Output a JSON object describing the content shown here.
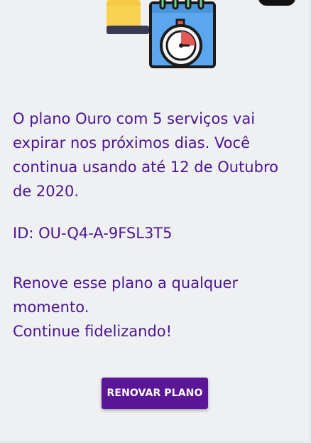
{
  "illustration": {
    "icon": "calendar-stopwatch-icon"
  },
  "message": {
    "text": "O plano Ouro com 5 serviços vai expirar nos próximos dias. Você continua usando até 12 de Outubro de 2020."
  },
  "plan": {
    "id_text": "ID: OU-Q4-A-9FSL3T5"
  },
  "renew": {
    "line1": "Renove esse plano a qualquer momento.",
    "line2": "Continue fidelizando!"
  },
  "button": {
    "label": "RENOVAR PLANO"
  },
  "colors": {
    "text": "#4b1491",
    "button_bg": "#5b1597",
    "background": "#eef0f2"
  }
}
